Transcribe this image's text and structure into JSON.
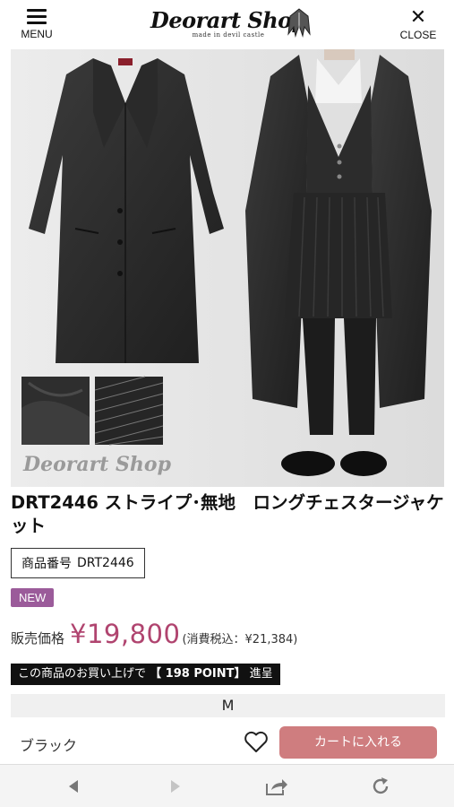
{
  "header": {
    "menu_label": "MENU",
    "logo_text": "Deorart Shop",
    "logo_sub": "made in devil castle",
    "close_label": "CLOSE"
  },
  "image": {
    "watermark": "Deorart Shop"
  },
  "product": {
    "title": "DRT2446 ストライプ･無地　ロングチェスタージャケット",
    "sku_label": "商品番号",
    "sku_value": "DRT2446",
    "badge": "NEW",
    "price_label": "販売価格",
    "price_value": "¥19,800",
    "price_tax": "(消費税込：¥21,384)",
    "points_text_pre": "この商品のお買い上げで",
    "points_text_strong": "【 198 POINT】",
    "points_text_post": "進呈",
    "size": "M",
    "color": "ブラック",
    "cart_label": "カートに入れる"
  },
  "colors": {
    "price": "#b0446f",
    "badge": "#9b5b9a",
    "cart_button": "#cf7d7f",
    "size_row_bg": "#f0f0f0"
  },
  "toolbar": {
    "icons": [
      "back-icon",
      "forward-icon",
      "share-icon",
      "reload-icon"
    ]
  }
}
